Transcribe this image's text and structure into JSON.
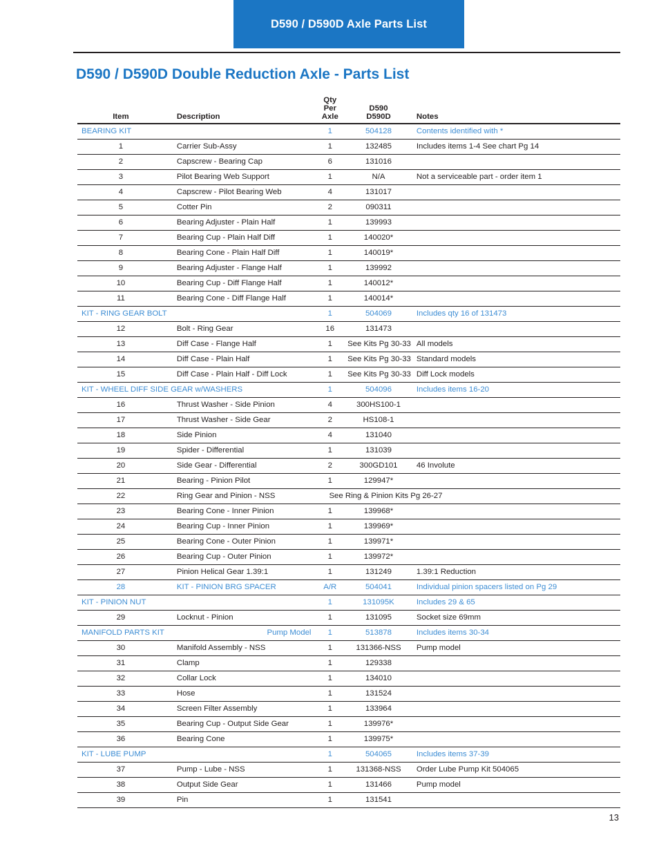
{
  "banner": {
    "title": "D590 / D590D Axle Parts List"
  },
  "page_title": "D590 / D590D Double Reduction Axle - Parts List",
  "page_number": "13",
  "colors": {
    "banner_blue": "#1b76c4",
    "title_blue": "#1b76c4",
    "link_blue": "#3d8dd4",
    "text_dark": "#231f20"
  },
  "table": {
    "headers": {
      "item": "Item",
      "description": "Description",
      "qty_line1": "Qty",
      "qty_line2": "Per",
      "qty_line3": "Axle",
      "pn_line1": "D590",
      "pn_line2": "D590D",
      "notes": "Notes"
    },
    "rows": [
      {
        "type": "kit",
        "item": "",
        "description": "BEARING KIT",
        "extra": "",
        "qty": "1",
        "pn": "504128",
        "notes": "Contents identified with *"
      },
      {
        "type": "part",
        "item": "1",
        "description": "Carrier Sub-Assy",
        "qty": "1",
        "pn": "132485",
        "notes": "Includes items 1-4 See chart Pg 14"
      },
      {
        "type": "part",
        "item": "2",
        "description": "Capscrew - Bearing Cap",
        "qty": "6",
        "pn": "131016",
        "notes": ""
      },
      {
        "type": "part",
        "item": "3",
        "description": "Pilot Bearing Web Support",
        "qty": "1",
        "pn": "N/A",
        "notes": "Not a serviceable part - order item 1"
      },
      {
        "type": "part",
        "item": "4",
        "description": "Capscrew - Pilot Bearing Web",
        "qty": "4",
        "pn": "131017",
        "notes": ""
      },
      {
        "type": "part",
        "item": "5",
        "description": "Cotter Pin",
        "qty": "2",
        "pn": "090311",
        "notes": ""
      },
      {
        "type": "part",
        "item": "6",
        "description": "Bearing Adjuster - Plain Half",
        "qty": "1",
        "pn": "139993",
        "notes": ""
      },
      {
        "type": "part",
        "item": "7",
        "description": "Bearing Cup - Plain Half Diff",
        "qty": "1",
        "pn": "140020*",
        "notes": ""
      },
      {
        "type": "part",
        "item": "8",
        "description": "Bearing Cone - Plain Half Diff",
        "qty": "1",
        "pn": "140019*",
        "notes": ""
      },
      {
        "type": "part",
        "item": "9",
        "description": "Bearing Adjuster - Flange Half",
        "qty": "1",
        "pn": "139992",
        "notes": ""
      },
      {
        "type": "part",
        "item": "10",
        "description": "Bearing Cup - Diff Flange Half",
        "qty": "1",
        "pn": "140012*",
        "notes": ""
      },
      {
        "type": "part",
        "item": "11",
        "description": "Bearing Cone - Diff Flange Half",
        "qty": "1",
        "pn": "140014*",
        "notes": ""
      },
      {
        "type": "kit",
        "item": "",
        "description": "KIT - RING GEAR BOLT",
        "extra": "",
        "qty": "1",
        "pn": "504069",
        "notes": "Includes qty 16 of 131473"
      },
      {
        "type": "part",
        "item": "12",
        "description": "Bolt - Ring Gear",
        "qty": "16",
        "pn": "131473",
        "notes": ""
      },
      {
        "type": "wide",
        "item": "13",
        "description": "Diff Case - Flange Half",
        "qty": "1",
        "pn": "See Kits Pg 30-33",
        "notes": "All models"
      },
      {
        "type": "wide",
        "item": "14",
        "description": "Diff Case - Plain Half",
        "qty": "1",
        "pn": "See Kits Pg 30-33",
        "notes": "Standard models"
      },
      {
        "type": "wide",
        "item": "15",
        "description": "Diff Case - Plain Half - Diff Lock",
        "qty": "1",
        "pn": "See Kits Pg 30-33",
        "notes": "Diff Lock models"
      },
      {
        "type": "kit",
        "item": "",
        "description": "KIT - WHEEL DIFF SIDE GEAR w/WASHERS",
        "extra": "",
        "qty": "1",
        "pn": "504096",
        "notes": "Includes items 16-20"
      },
      {
        "type": "part",
        "item": "16",
        "description": "Thrust Washer - Side Pinion",
        "qty": "4",
        "pn": "300HS100-1",
        "notes": ""
      },
      {
        "type": "part",
        "item": "17",
        "description": "Thrust Washer - Side Gear",
        "qty": "2",
        "pn": "HS108-1",
        "notes": ""
      },
      {
        "type": "part",
        "item": "18",
        "description": "Side Pinion",
        "qty": "4",
        "pn": "131040",
        "notes": ""
      },
      {
        "type": "part",
        "item": "19",
        "description": "Spider - Differential",
        "qty": "1",
        "pn": "131039",
        "notes": ""
      },
      {
        "type": "part",
        "item": "20",
        "description": "Side Gear - Differential",
        "qty": "2",
        "pn": "300GD101",
        "notes": "46 Involute"
      },
      {
        "type": "part",
        "item": "21",
        "description": "Bearing - Pinion Pilot",
        "qty": "1",
        "pn": "129947*",
        "notes": ""
      },
      {
        "type": "span",
        "item": "22",
        "description": "Ring Gear and Pinion - NSS",
        "span_text": "See Ring & Pinion Kits Pg 26-27"
      },
      {
        "type": "part",
        "item": "23",
        "description": "Bearing Cone - Inner Pinion",
        "qty": "1",
        "pn": "139968*",
        "notes": ""
      },
      {
        "type": "part",
        "item": "24",
        "description": "Bearing Cup - Inner Pinion",
        "qty": "1",
        "pn": "139969*",
        "notes": ""
      },
      {
        "type": "part",
        "item": "25",
        "description": "Bearing Cone - Outer Pinion",
        "qty": "1",
        "pn": "139971*",
        "notes": ""
      },
      {
        "type": "part",
        "item": "26",
        "description": "Bearing Cup - Outer Pinion",
        "qty": "1",
        "pn": "139972*",
        "notes": ""
      },
      {
        "type": "part",
        "item": "27",
        "description": "Pinion Helical Gear 1.39:1",
        "qty": "1",
        "pn": "131249",
        "notes": "1.39:1 Reduction"
      },
      {
        "type": "blue-part",
        "item": "28",
        "description": "KIT - PINION BRG SPACER",
        "qty": "A/R",
        "pn": "504041",
        "notes": "Individual pinion spacers listed on Pg 29"
      },
      {
        "type": "kit",
        "item": "",
        "description": "KIT - PINION NUT",
        "extra": "",
        "qty": "1",
        "pn": "131095K",
        "notes": "Includes  29 & 65"
      },
      {
        "type": "part",
        "item": "29",
        "description": "Locknut - Pinion",
        "qty": "1",
        "pn": "131095",
        "notes": "Socket size 69mm"
      },
      {
        "type": "kit",
        "item": "",
        "description": "MANIFOLD PARTS KIT",
        "extra": "Pump Model",
        "qty": "1",
        "pn": "513878",
        "notes": "Includes items 30-34"
      },
      {
        "type": "part",
        "item": "30",
        "description": "Manifold Assembly - NSS",
        "qty": "1",
        "pn": "131366-NSS",
        "notes": "Pump model"
      },
      {
        "type": "part",
        "item": "31",
        "description": "Clamp",
        "qty": "1",
        "pn": "129338",
        "notes": ""
      },
      {
        "type": "part",
        "item": "32",
        "description": "Collar Lock",
        "qty": "1",
        "pn": "134010",
        "notes": ""
      },
      {
        "type": "part",
        "item": "33",
        "description": "Hose",
        "qty": "1",
        "pn": "131524",
        "notes": ""
      },
      {
        "type": "part",
        "item": "34",
        "description": "Screen Filter Assembly",
        "qty": "1",
        "pn": "133964",
        "notes": ""
      },
      {
        "type": "part",
        "item": "35",
        "description": "Bearing Cup - Output Side Gear",
        "qty": "1",
        "pn": "139976*",
        "notes": ""
      },
      {
        "type": "part",
        "item": "36",
        "description": "Bearing Cone",
        "qty": "1",
        "pn": "139975*",
        "notes": ""
      },
      {
        "type": "kit",
        "item": "",
        "description": "KIT - LUBE PUMP",
        "extra": "",
        "qty": "1",
        "pn": "504065",
        "notes": "Includes items 37-39"
      },
      {
        "type": "part",
        "item": "37",
        "description": "Pump - Lube - NSS",
        "qty": "1",
        "pn": "131368-NSS",
        "notes": "Order Lube Pump Kit  504065"
      },
      {
        "type": "part",
        "item": "38",
        "description": "Output Side Gear",
        "qty": "1",
        "pn": "131466",
        "notes": "Pump model"
      },
      {
        "type": "part",
        "item": "39",
        "description": "Pin",
        "qty": "1",
        "pn": "131541",
        "notes": ""
      }
    ]
  }
}
